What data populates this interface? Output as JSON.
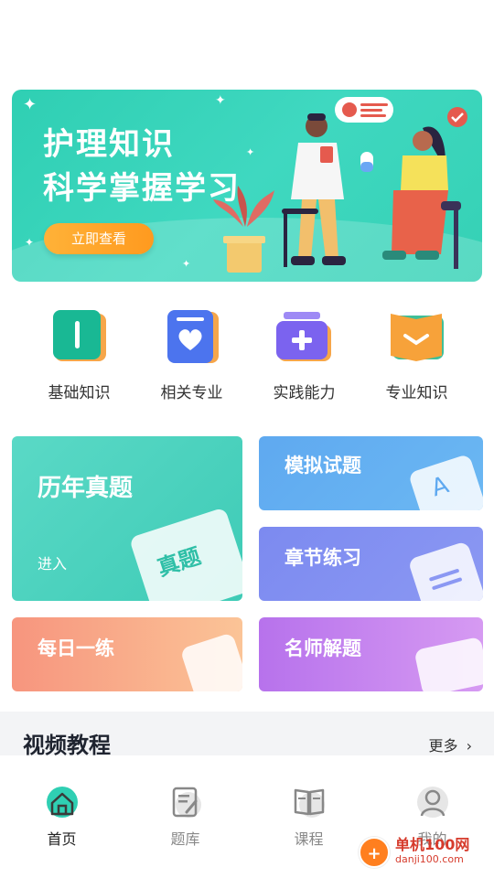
{
  "banner": {
    "title_line1": "护理知识",
    "title_line2": "科学掌握学习",
    "button_label": "立即查看"
  },
  "categories": [
    {
      "label": "基础知识",
      "icon": "book-icon",
      "color": "#1bbf9e"
    },
    {
      "label": "相关专业",
      "icon": "heart-card-icon",
      "color": "#4d78f0"
    },
    {
      "label": "实践能力",
      "icon": "medical-kit-icon",
      "color": "#7a62f0"
    },
    {
      "label": "专业知识",
      "icon": "open-book-icon",
      "color": "#f59a2f"
    }
  ],
  "cards": {
    "history": {
      "title": "历年真题",
      "subtitle": "进入",
      "deco_text": "真题"
    },
    "mock": {
      "title": "模拟试题",
      "deco_text": "A"
    },
    "chapter": {
      "title": "章节练习"
    },
    "daily": {
      "title": "每日一练"
    },
    "teacher": {
      "title": "名师解题"
    }
  },
  "video": {
    "title": "视频教程",
    "more_label": "更多"
  },
  "tabs": [
    {
      "label": "首页",
      "icon": "home-icon",
      "active": true
    },
    {
      "label": "题库",
      "icon": "question-bank-icon",
      "active": false
    },
    {
      "label": "课程",
      "icon": "course-icon",
      "active": false
    },
    {
      "label": "我的",
      "icon": "profile-icon",
      "active": false
    }
  ],
  "watermark": {
    "name": "单机100网",
    "url": "danji100.com"
  },
  "colors": {
    "primary": "#2fcfb3",
    "accent_orange": "#ffa226",
    "text_dark": "#1f2430"
  }
}
